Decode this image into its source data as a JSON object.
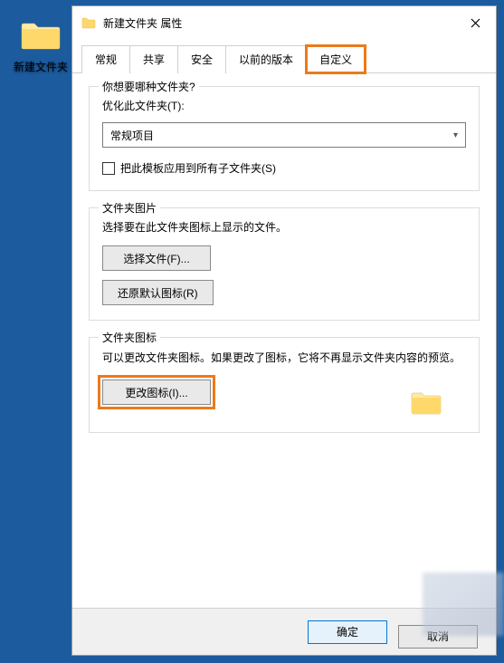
{
  "desktop": {
    "folder_label": "新建文件夹"
  },
  "dialog": {
    "title": "新建文件夹 属性",
    "tabs": {
      "general": "常规",
      "sharing": "共享",
      "security": "安全",
      "previous": "以前的版本",
      "customize": "自定义"
    },
    "group1": {
      "legend": "你想要哪种文件夹?",
      "optimize_label": "优化此文件夹(T):",
      "select_value": "常规项目",
      "apply_checkbox": "把此模板应用到所有子文件夹(S)"
    },
    "group2": {
      "legend": "文件夹图片",
      "desc": "选择要在此文件夹图标上显示的文件。",
      "choose_btn": "选择文件(F)...",
      "restore_btn": "还原默认图标(R)"
    },
    "group3": {
      "legend": "文件夹图标",
      "desc": "可以更改文件夹图标。如果更改了图标，它将不再显示文件夹内容的预览。",
      "change_btn": "更改图标(I)..."
    },
    "footer": {
      "ok": "确定",
      "cancel": "取消"
    }
  }
}
